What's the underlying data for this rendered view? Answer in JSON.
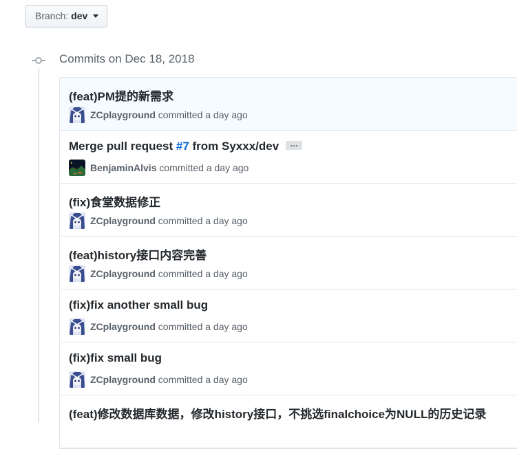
{
  "branch": {
    "prefix": "Branch:",
    "name": "dev"
  },
  "group": {
    "title": "Commits on Dec 18, 2018"
  },
  "commits": [
    {
      "title": "(feat)PM提的新需求",
      "author": "ZCplayground",
      "action": "committed",
      "time": "a day ago",
      "avatar": "anime-avatar"
    },
    {
      "title_prefix": "Merge pull request ",
      "pr_ref": "#7",
      "title_suffix": " from Syxxx/dev",
      "ellipsis": "…",
      "author": "BenjaminAlvis",
      "action": "committed",
      "time": "a day ago",
      "avatar": "landscape-avatar"
    },
    {
      "title": "(fix)食堂数据修正",
      "author": "ZCplayground",
      "action": "committed",
      "time": "a day ago",
      "avatar": "anime-avatar"
    },
    {
      "title": "(feat)history接口内容完善",
      "author": "ZCplayground",
      "action": "committed",
      "time": "a day ago",
      "avatar": "anime-avatar"
    },
    {
      "title": "(fix)fix another small bug",
      "author": "ZCplayground",
      "action": "committed",
      "time": "a day ago",
      "avatar": "anime-avatar"
    },
    {
      "title": "(fix)fix small bug",
      "author": "ZCplayground",
      "action": "committed",
      "time": "a day ago",
      "avatar": "anime-avatar"
    },
    {
      "title": "(feat)修改数据库数据，修改history接口，不挑选finalchoice为NULL的历史记录"
    }
  ],
  "colors": {
    "link": "#0366d6",
    "highlight_bg": "#f6fbff",
    "border": "#e1e4e8"
  }
}
